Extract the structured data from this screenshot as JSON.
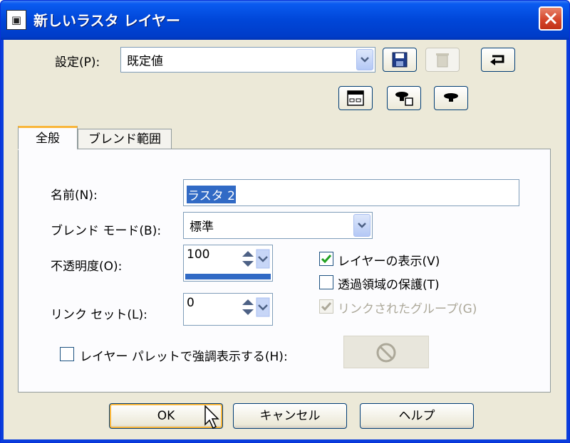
{
  "window": {
    "title": "新しいラスタ レイヤー",
    "icon": "app-layer-icon",
    "close_icon": "close-icon"
  },
  "preset": {
    "label": "設定(P):",
    "value": "既定値",
    "icons": [
      "save-icon",
      "delete-icon",
      "reset-icon",
      "dialog-icon",
      "load-icon",
      "save-preset-icon"
    ]
  },
  "tabs": [
    {
      "label": "全般",
      "active": true
    },
    {
      "label": "ブレンド範囲",
      "active": false
    }
  ],
  "general": {
    "name_label": "名前(N):",
    "name_value": "ラスタ 2",
    "blend_label": "ブレンド モード(B):",
    "blend_value": "標準",
    "opacity_label": "不透明度(O):",
    "opacity_value": "100",
    "linkset_label": "リンク セット(L):",
    "linkset_value": "0",
    "show_layer_label": "レイヤーの表示(V)",
    "show_layer_checked": true,
    "protect_label": "透過領域の保護(T)",
    "protect_checked": false,
    "linked_group_label": "リンクされたグループ(G)",
    "linked_group_checked": true,
    "highlight_label": "レイヤー パレットで強調表示する(H):",
    "highlight_checked": false
  },
  "buttons": {
    "ok": "OK",
    "cancel": "キャンセル",
    "help": "ヘルプ"
  },
  "colors": {
    "titlebar": "#0046d8",
    "dialog_bg": "#ece9d8",
    "tab_accent": "#f9b63a",
    "selection": "#316ac5"
  }
}
